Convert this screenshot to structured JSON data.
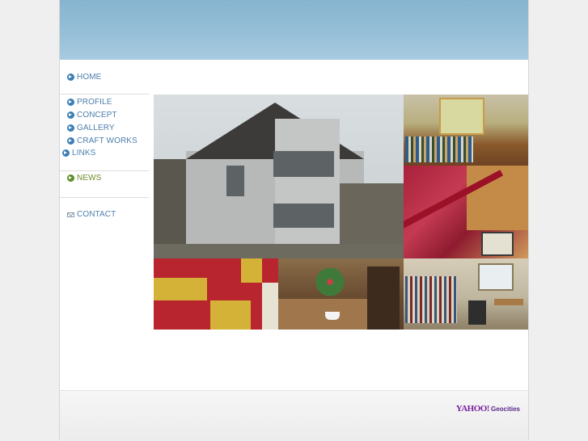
{
  "nav": {
    "home": "HOME",
    "profile": "PROFILE",
    "concept": "CONCEPT",
    "gallery": "GALLERY",
    "craft_works": "CRAFT WORKS",
    "links": "LINKS",
    "news": "NEWS",
    "contact": "CONTACT"
  },
  "icons": {
    "nav_arrow": "circle-arrow-icon",
    "contact": "envelope-icon"
  },
  "colors": {
    "header": "#96bfd7",
    "nav_text": "#4d7fae",
    "news_text": "#6f8a2a",
    "badge": "#7b1fa2"
  },
  "footer": {
    "badge_brand": "YAHOO!",
    "badge_product": "Geocities"
  }
}
